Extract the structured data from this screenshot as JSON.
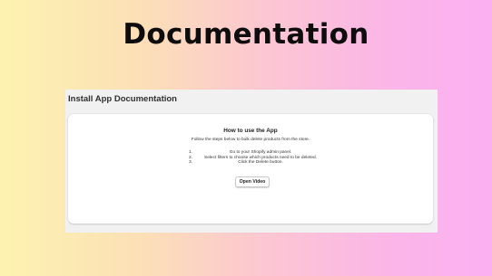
{
  "banner": {
    "title": "Documentation"
  },
  "panel": {
    "title": "Install App Documentation"
  },
  "card": {
    "heading": "How to use the App",
    "subtitle": "Follow the steps below to bulk delete products from the store.",
    "steps": [
      {
        "number": "1.",
        "text": "Go to your Shopify admin panel."
      },
      {
        "number": "2.",
        "text": "Select filters to choose which products need to be deleted."
      },
      {
        "number": "3.",
        "text": "Click the Delete button."
      }
    ],
    "button_label": "Open Video"
  },
  "colors": {
    "gradient_start": "#fdf3b0",
    "gradient_end": "#fbb0f3",
    "panel_background": "#f1f1f1",
    "card_background": "#ffffff"
  }
}
